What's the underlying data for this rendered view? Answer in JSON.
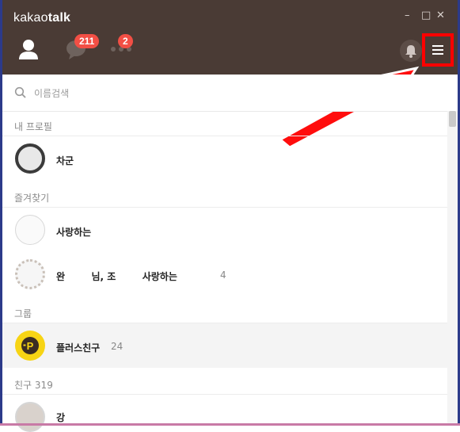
{
  "app": {
    "title_light": "kakao",
    "title_bold": "talk"
  },
  "window": {
    "minimize": "–",
    "maximize": "□",
    "close": "✕"
  },
  "nav": {
    "friends_icon": "person-icon",
    "chats_badge": "211",
    "more_badge": "2"
  },
  "search": {
    "placeholder": "이름검색"
  },
  "sections": {
    "my_profile": "내 프로필",
    "favorites": "즐겨찾기",
    "groups": "그룹",
    "friends_label": "친구",
    "friends_count": "319"
  },
  "my_profile": {
    "name": "차군"
  },
  "favorites": [
    {
      "name": "사랑하는",
      "count": ""
    },
    {
      "name": "완        님, 조        사랑하는",
      "count": "4"
    }
  ],
  "groups": [
    {
      "name": "플러스친구",
      "count": "24"
    }
  ],
  "friends": [
    {
      "name": "강"
    }
  ],
  "colors": {
    "header_bg": "#4a3b35",
    "badge": "#f24f45",
    "highlight_box": "#ff0000",
    "plus_friend": "#f7d414"
  }
}
